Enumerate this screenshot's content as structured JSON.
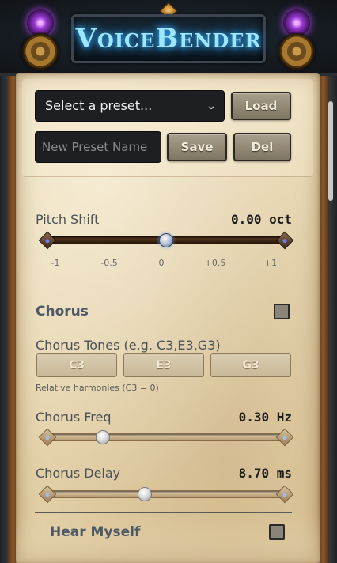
{
  "app": {
    "title": "VoiceBender"
  },
  "preset": {
    "select_value": "Select a preset...",
    "load_label": "Load",
    "name_placeholder": "New Preset Name",
    "save_label": "Save",
    "delete_label": "Del"
  },
  "pitch": {
    "label": "Pitch Shift",
    "value": "0.00 oct",
    "ticks": [
      "-1",
      "-0.5",
      "0",
      "+0.5",
      "+1"
    ],
    "level": 0.5
  },
  "chorus": {
    "title": "Chorus",
    "enabled": false,
    "tones_label": "Chorus Tones (e.g. C3,E3,G3)",
    "tones": [
      "C3",
      "E3",
      "G3"
    ],
    "hint": "Relative harmonies (C3 = 0)",
    "freq_label": "Chorus Freq",
    "freq_value": "0.30 Hz",
    "freq_level": 0.2,
    "delay_label": "Chorus Delay",
    "delay_value": "8.70 ms",
    "delay_level": 0.4
  },
  "hear_myself": {
    "title": "Hear Myself",
    "enabled": false
  },
  "colors": {
    "title_glow": "#38b6ff",
    "parchment": "#e9d9b4",
    "button": "#948a76",
    "label": "#4a5257"
  }
}
